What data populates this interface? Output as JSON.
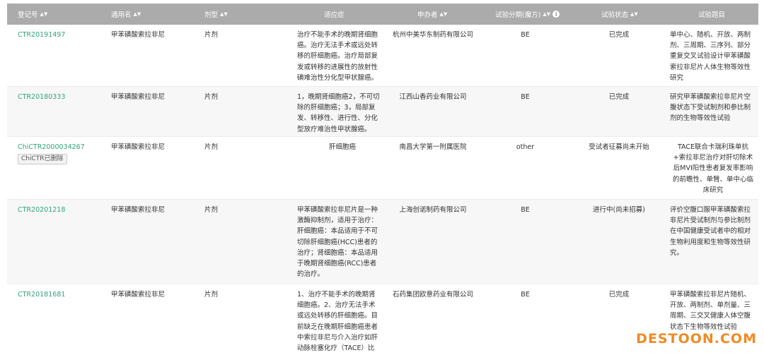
{
  "headers": {
    "reg_no": "登记号",
    "generic": "通用名",
    "form": "剂型",
    "indication": "适应症",
    "sponsor": "申办者",
    "phase": "试验分期(魔方)",
    "status": "试验状态",
    "title": "试验题目"
  },
  "icons": {
    "sort": "sort-icon",
    "info": "info-icon"
  },
  "colors": {
    "header_bg": "#ababab",
    "link": "#33a37f",
    "watermark": "#f08a24"
  },
  "rows": [
    {
      "reg_no": "CTR20191497",
      "generic": "甲苯磺酸索拉非尼",
      "form": "片剂",
      "indication": [
        "治疗不能手术的晚期肾细胞",
        "癌。治疗无法手术或远处转",
        "移的肝细胞癌。治疗局部复",
        "发或转移的进展性的放射性",
        "碘难治性分化型甲状腺癌。"
      ],
      "sponsor": "杭州中美华东制药有限公司",
      "phase": "BE",
      "status": "已完成",
      "title": [
        "单中心、随机、开放、两制",
        "剂、三周期、三序列、部分",
        "重复交叉试验设计甲苯磺酸",
        "索拉非尼片人体生物等效性",
        "研究"
      ]
    },
    {
      "reg_no": "CTR20180333",
      "generic": "甲苯磺酸索拉非尼",
      "form": "片剂",
      "indication": [
        "1，晚期肾细胞癌2，不可切",
        "除的肝细胞癌；3，局部复",
        "发、转移性、进行性、分化",
        "型放疗难治性甲状腺癌。"
      ],
      "sponsor": "江西山香药业有限公司",
      "phase": "BE",
      "status": "已完成",
      "title": [
        "研究甲苯磺酸索拉非尼片空",
        "腹状态下受试制剂和参比制",
        "剂的生物等效性试验"
      ]
    },
    {
      "reg_no": "ChiCTR2000034267",
      "badge": "ChiCTR已删除",
      "generic": "甲苯磺酸索拉非尼",
      "form": "片剂",
      "indication": [
        "肝细胞癌"
      ],
      "sponsor": "南昌大学第一附属医院",
      "phase": "other",
      "status": "受试者征募尚未开始",
      "title": [
        "TACE联合卡瑞利珠单抗",
        "+索拉非尼治疗对肝切除术",
        "后MVI阳性患者复发率影响",
        "的前瞻性、单臂、单中心临",
        "床研究"
      ]
    },
    {
      "reg_no": "CTR20201218",
      "generic": "甲苯磺酸索拉非尼",
      "form": "片剂",
      "indication": [
        "甲苯磺酸索拉非尼片是一种",
        "激酶抑制剂，适用于治疗：",
        "肝细胞癌：本品适用于不可",
        "切除肝细胞癌(HCC)患者的",
        "治疗；肾细胞癌：本品适用",
        "于晚期肾细胞癌(RCC)患者",
        "的治疗。"
      ],
      "sponsor": "上海创诺制药有限公司",
      "phase": "BE",
      "status": "进行中(尚未招募)",
      "title": [
        "评价空腹口服甲苯磺酸索拉",
        "非尼片受试制剂与参比制剂",
        "在中国健康受试者中的相对",
        "生物利用度和生物等效性研",
        "究。"
      ]
    },
    {
      "reg_no": "CTR20181681",
      "generic": "甲苯磺酸索拉非尼",
      "form": "片剂",
      "indication": [
        "1、治疗不能手术的晚期肾",
        "细胞癌。2、治疗无法手术",
        "或远处转移的肝细胞癌。目",
        "前缺乏在晚期肝细胞癌患者",
        "中索拉非尼与介入治疗如肝",
        "动脉栓塞化疗（TACE）比"
      ],
      "sponsor": "石药集团欧意药业有限公司",
      "phase": "BE",
      "status": "已完成",
      "title": [
        "甲苯磺酸索拉非尼片随机、",
        "开放、两制剂、单剂量、三",
        "周期、三交叉健康人体空腹",
        "状态下生物等效性试验"
      ]
    }
  ],
  "watermark": "DESTOON.COM"
}
